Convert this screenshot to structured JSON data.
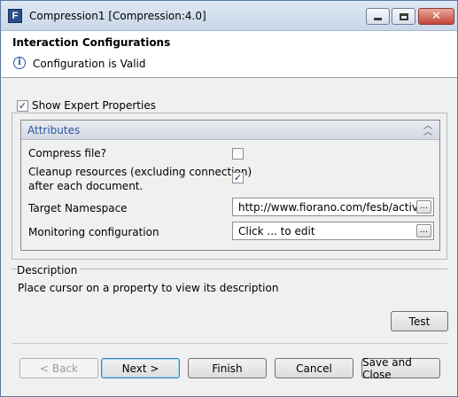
{
  "window": {
    "title": "Compression1 [Compression:4.0]",
    "app_icon_letter": "F"
  },
  "header": {
    "title": "Interaction Configurations",
    "status": "Configuration is Valid"
  },
  "expert_properties": {
    "label": "Show Expert Properties",
    "checked": true
  },
  "attributes": {
    "section_label": "Attributes",
    "rows": [
      {
        "label": "Compress file?",
        "type": "checkbox",
        "checked": false
      },
      {
        "label": "Cleanup resources (excluding connection)",
        "label2": "after each document.",
        "type": "checkbox",
        "checked": true
      },
      {
        "label": "Target Namespace",
        "type": "text",
        "value": "http://www.fiorano.com/fesb/activity"
      },
      {
        "label": "Monitoring configuration",
        "type": "text",
        "value": "Click ... to edit"
      }
    ]
  },
  "description": {
    "title": "Description",
    "text": "Place cursor on a property to view its description"
  },
  "buttons": {
    "test": "Test",
    "back": "< Back",
    "next": "Next >",
    "finish": "Finish",
    "cancel": "Cancel",
    "save_close": "Save and Close"
  },
  "icons": {
    "app": "fiorano-app-icon",
    "info": "info-icon",
    "collapse": "double-chevron-up-icon",
    "ellipsis": "ellipsis-button-icon"
  }
}
